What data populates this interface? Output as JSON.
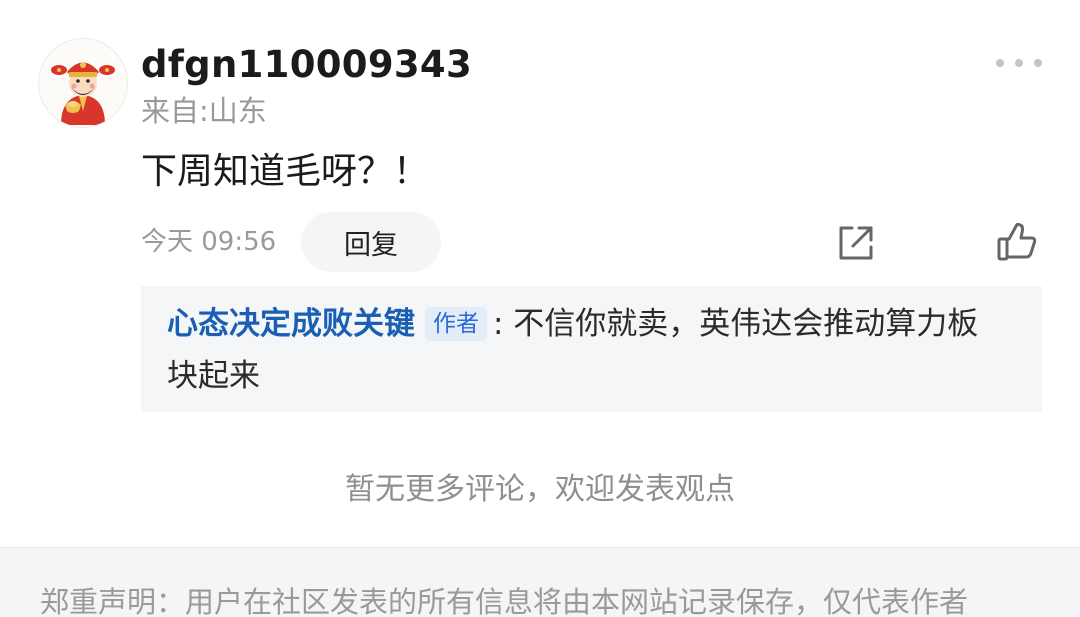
{
  "comment": {
    "username": "dfgn110009343",
    "location": "来自:山东",
    "text": "下周知道毛呀？！",
    "time": "今天 09:56",
    "reply_label": "回复"
  },
  "reply": {
    "author": "心态决定成败关键",
    "badge": "作者",
    "text": ": 不信你就卖，英伟达会推动算力板块起来"
  },
  "footer": {
    "end_message": "暂无更多评论，欢迎发表观点",
    "disclaimer": "郑重声明：用户在社区发表的所有信息将由本网站记录保存，仅代表作者"
  },
  "icons": {
    "avatar": "fortune-god-avatar",
    "more": "more-dots-icon",
    "share": "share-icon",
    "like": "thumbs-up-icon"
  },
  "colors": {
    "author_link": "#1a5fb4",
    "badge_bg": "#e3ecf8",
    "reply_bg": "#f5f6f8"
  }
}
